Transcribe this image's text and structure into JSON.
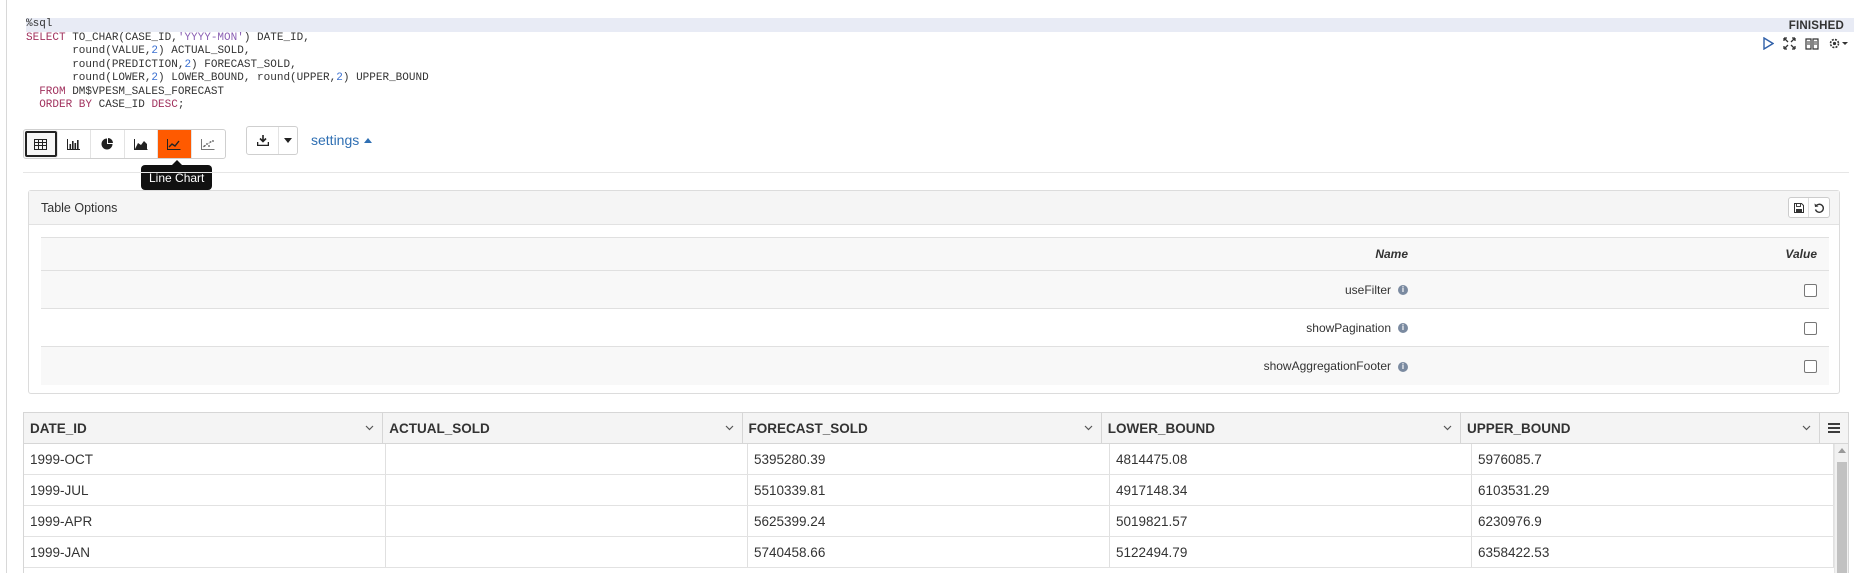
{
  "paragraph": {
    "status": "FINISHED",
    "code_lines": [
      "%sql",
      "SELECT TO_CHAR(CASE_ID,'YYYY-MON') DATE_ID,",
      "       round(VALUE,2) ACTUAL_SOLD,",
      "       round(PREDICTION,2) FORECAST_SOLD,",
      "       round(LOWER,2) LOWER_BOUND, round(UPPER,2) UPPER_BOUND",
      "  FROM DM$VPESM_SALES_FORECAST",
      "  ORDER BY CASE_ID DESC;"
    ],
    "controls": [
      "run-icon",
      "expand-icon",
      "book-icon",
      "gear-icon"
    ]
  },
  "toolbar": {
    "viz_buttons": [
      {
        "icon": "table-icon",
        "state": "selected"
      },
      {
        "icon": "bar-chart-icon",
        "state": ""
      },
      {
        "icon": "pie-chart-icon",
        "state": ""
      },
      {
        "icon": "area-chart-icon",
        "state": ""
      },
      {
        "icon": "line-chart-icon",
        "state": "hover"
      },
      {
        "icon": "scatter-chart-icon",
        "state": ""
      }
    ],
    "tooltip": "Line Chart",
    "settings_label": "settings",
    "accent_color": "#ff5a00"
  },
  "table_options": {
    "title": "Table Options",
    "col_name": "Name",
    "col_value": "Value",
    "rows": [
      {
        "name": "useFilter",
        "checked": false
      },
      {
        "name": "showPagination",
        "checked": false
      },
      {
        "name": "showAggregationFooter",
        "checked": false
      }
    ]
  },
  "grid": {
    "columns": [
      "DATE_ID",
      "ACTUAL_SOLD",
      "FORECAST_SOLD",
      "LOWER_BOUND",
      "UPPER_BOUND"
    ],
    "rows": [
      [
        "1999-OCT",
        "",
        "5395280.39",
        "4814475.08",
        "5976085.7"
      ],
      [
        "1999-JUL",
        "",
        "5510339.81",
        "4917148.34",
        "6103531.29"
      ],
      [
        "1999-APR",
        "",
        "5625399.24",
        "5019821.57",
        "6230976.9"
      ],
      [
        "1999-JAN",
        "",
        "5740458.66",
        "5122494.79",
        "6358422.53"
      ]
    ]
  }
}
